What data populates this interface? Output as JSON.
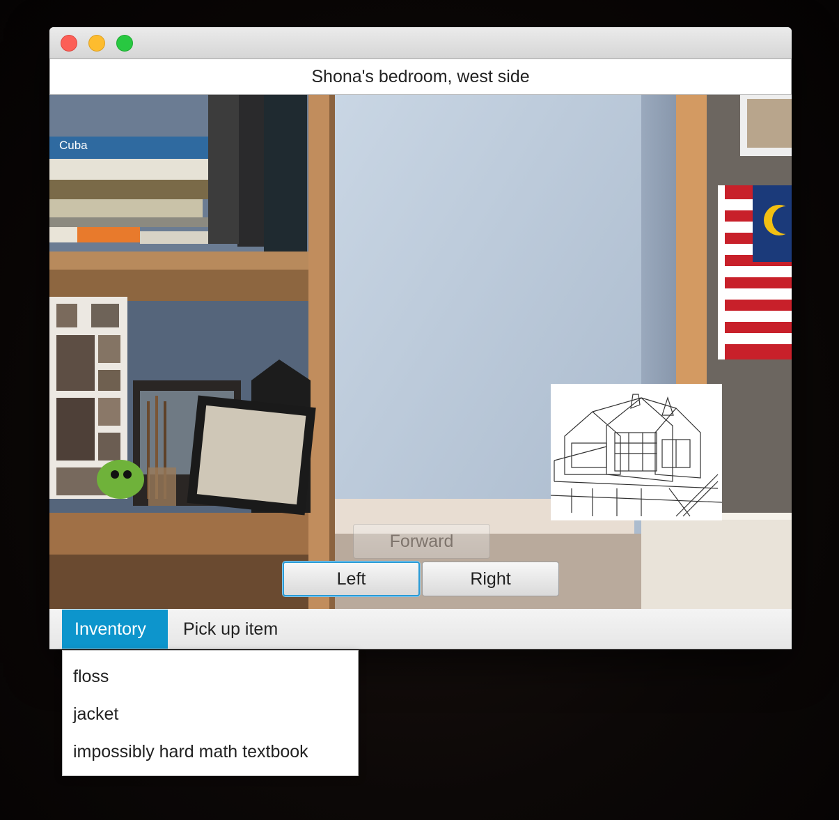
{
  "window": {
    "location_title": "Shona's bedroom, west side"
  },
  "navigation": {
    "forward_label": "Forward",
    "left_label": "Left",
    "right_label": "Right",
    "forward_enabled": false,
    "focused_button": "Left"
  },
  "scene_text": {
    "book_spine": "Cuba"
  },
  "tabs": [
    {
      "label": "Inventory",
      "active": true
    },
    {
      "label": "Pick up item",
      "active": false
    }
  ],
  "inventory": {
    "items": [
      "floss",
      "jacket",
      "impossibly hard math textbook"
    ]
  },
  "colors": {
    "accent": "#0d95cc",
    "focus_ring": "#2a9bd6",
    "close": "#fc5f57",
    "minimize": "#fdbc2e",
    "maximize": "#28c841"
  },
  "icons": {
    "close": "close-icon",
    "minimize": "minimize-icon",
    "maximize": "maximize-icon"
  }
}
